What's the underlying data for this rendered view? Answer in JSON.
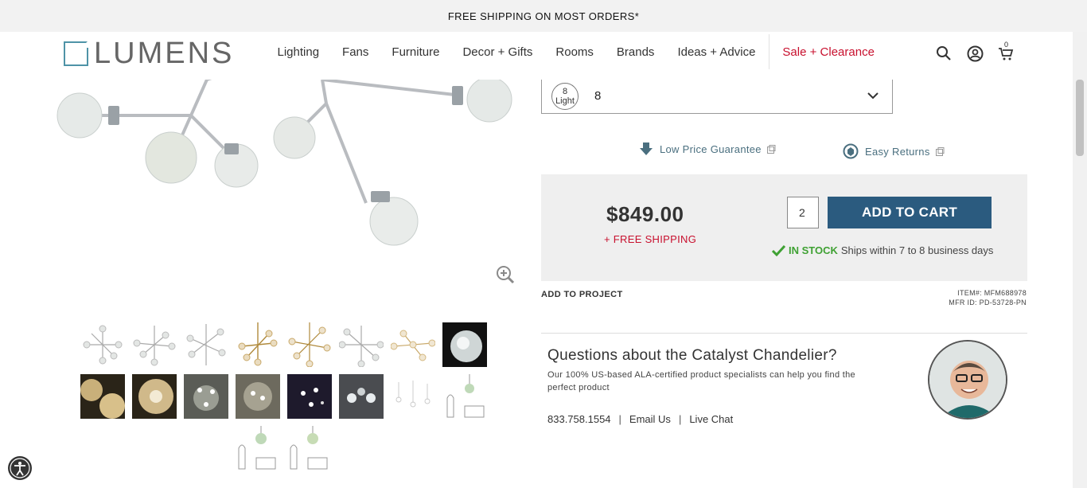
{
  "promo": {
    "text": "FREE SHIPPING ON MOST ORDERS*"
  },
  "logo": {
    "text": "LUMENS"
  },
  "nav": [
    {
      "label": "Lighting"
    },
    {
      "label": "Fans"
    },
    {
      "label": "Furniture"
    },
    {
      "label": "Decor + Gifts"
    },
    {
      "label": "Rooms"
    },
    {
      "label": "Brands"
    },
    {
      "label": "Ideas + Advice"
    },
    {
      "label": "Sale + Clearance"
    }
  ],
  "header_icons": {
    "search": "search-icon",
    "account": "user-icon",
    "cart": "cart-icon",
    "cart_count": "0"
  },
  "option_select": {
    "badge_number": "8",
    "badge_text": "Light",
    "value": "8"
  },
  "guarantees": {
    "low_price": "Low Price Guarantee",
    "returns": "Easy Returns"
  },
  "purchase": {
    "price": "$849.00",
    "shipping": "+ FREE SHIPPING",
    "quantity": "2",
    "add_to_cart": "ADD TO CART",
    "stock_status": "IN STOCK",
    "ships_text": "Ships within 7 to 8 business days"
  },
  "project": {
    "add_to_project": "ADD TO PROJECT",
    "item_no": "ITEM#: MFM688978",
    "mfr_id": "MFR ID: PD-53728-PN"
  },
  "questions": {
    "title": "Questions about the Catalyst Chandelier?",
    "text": "Our 100% US-based ALA-certified product specialists can help you find the perfect product",
    "phone": "833.758.1554",
    "email": "Email Us",
    "chat": "Live Chat"
  },
  "colors": {
    "brand_blue": "#2b5b7f",
    "sale_red": "#c8102e",
    "stock_green": "#3fa133",
    "logo_teal": "#4e93a7"
  }
}
